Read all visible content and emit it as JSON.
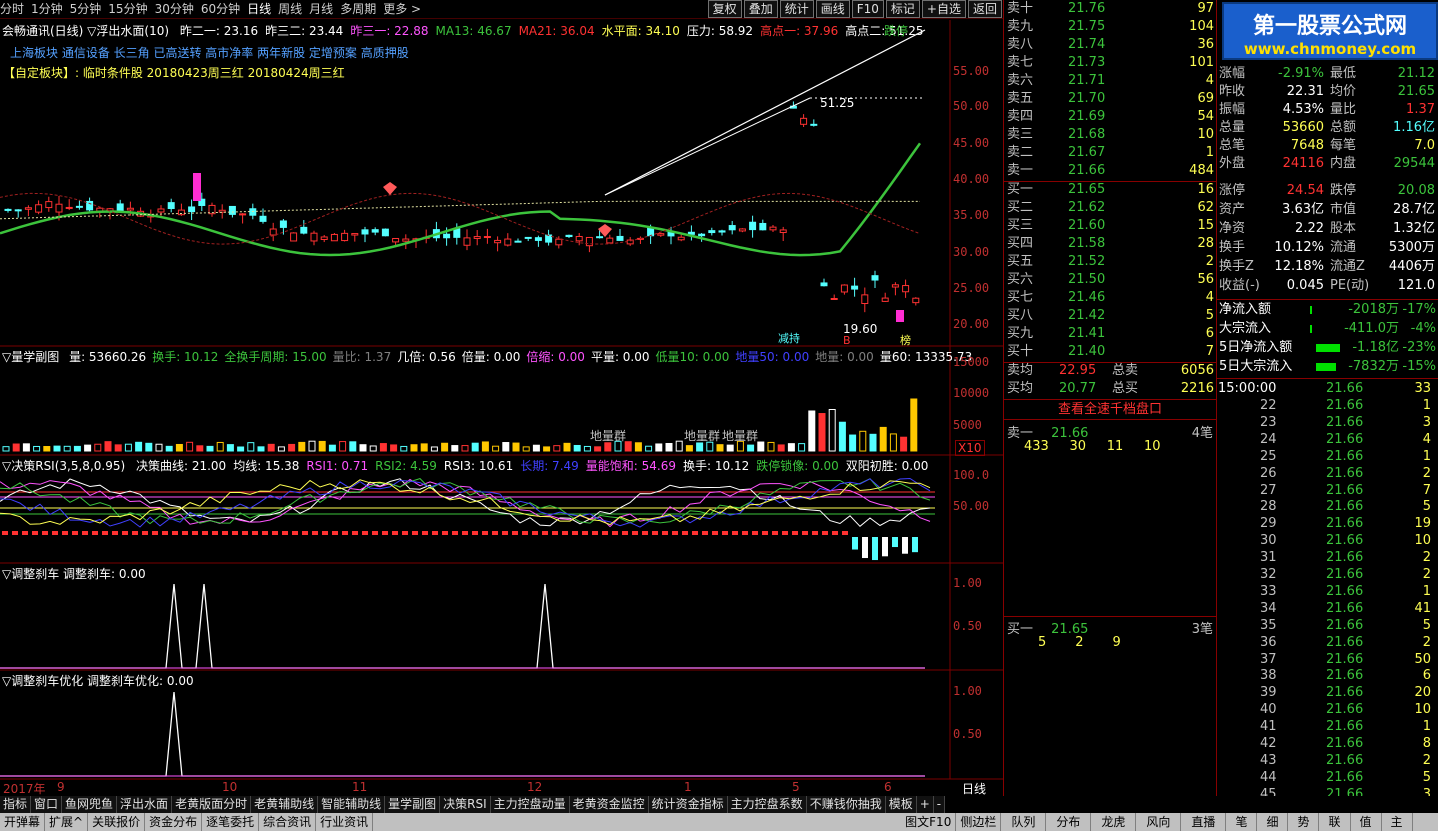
{
  "toolbar": {
    "periods": [
      "分时",
      "1分钟",
      "5分钟",
      "15分钟",
      "30分钟",
      "60分钟",
      "日线",
      "周线",
      "月线",
      "多周期",
      "更多 >"
    ],
    "active": "日线",
    "buttons": [
      "复权",
      "叠加",
      "统计",
      "画线",
      "F10",
      "标记",
      "+自选",
      "返回"
    ]
  },
  "watermark": {
    "title": "第一股票公式网",
    "url": "www.chnmoney.com"
  },
  "main_chart": {
    "title": "会畅通讯(日线) ▽浮出水面(10)",
    "ind": [
      {
        "label": "昨二一: 23.16",
        "color": "#ffffff"
      },
      {
        "label": "昨三二: 23.44",
        "color": "#ffffff"
      },
      {
        "label": "昨三一: 22.88",
        "color": "#ff54ff"
      },
      {
        "label": "MA13: 46.67",
        "color": "#3cc33c"
      },
      {
        "label": "MA21: 36.04",
        "color": "#ff3232"
      },
      {
        "label": "水平面: 34.10",
        "color": "#ffff54"
      },
      {
        "label": "压力: 58.92",
        "color": "#ffffff"
      },
      {
        "label": "高点一: 37.96",
        "color": "#ff3232"
      },
      {
        "label": "高点二: 51.25",
        "color": "#ffffff"
      }
    ],
    "tag": "跌停",
    "concepts": "上海板块 通信设备 长三角 已高送转 高市净率 两年新股 定增预案 高质押股",
    "custom": "【自定板块】: 临时条件股 20180423周三红 20180424周三红",
    "yticks": [
      "55.00",
      "50.00",
      "45.00",
      "40.00",
      "35.00",
      "30.00",
      "25.00",
      "20.00"
    ],
    "annot_high": "51.25",
    "annot_low": "19.60",
    "marks": [
      "减持",
      "B",
      "榜"
    ]
  },
  "vol_panel": {
    "title": "▽量学副图",
    "ind": [
      {
        "label": "量: 53660.26",
        "color": "#ffffff"
      },
      {
        "label": "换手: 10.12",
        "color": "#3cc33c"
      },
      {
        "label": "全换手周期: 15.00",
        "color": "#3cc33c"
      },
      {
        "label": "量比: 1.37",
        "color": "#808080"
      },
      {
        "label": "几倍: 0.56",
        "color": "#ffffff"
      },
      {
        "label": "倍量: 0.00",
        "color": "#ffffff"
      },
      {
        "label": "倍缩: 0.00",
        "color": "#ff54ff"
      },
      {
        "label": "平量: 0.00",
        "color": "#ffffff"
      },
      {
        "label": "低量10: 0.00",
        "color": "#3cc33c"
      },
      {
        "label": "地量50: 0.00",
        "color": "#4040ff"
      },
      {
        "label": "地量: 0.00",
        "color": "#808080"
      },
      {
        "label": "量60: 13335.73",
        "color": "#ffffff"
      }
    ],
    "yticks": [
      "15000",
      "10000",
      "5000"
    ],
    "ground_labels": [
      "地量群",
      "地量群",
      "地量群"
    ],
    "scale": "X10"
  },
  "rsi_panel": {
    "title": "▽决策RSI(3,5,8,0.95)",
    "ind": [
      {
        "label": "决策曲线: 21.00",
        "color": "#ffffff"
      },
      {
        "label": "均线: 15.38",
        "color": "#ffffff"
      },
      {
        "label": "RSI1: 0.71",
        "color": "#ff54ff"
      },
      {
        "label": "RSI2: 4.59",
        "color": "#3cc33c"
      },
      {
        "label": "RSI3: 10.61",
        "color": "#ffffff"
      },
      {
        "label": "长期: 7.49",
        "color": "#4040ff"
      },
      {
        "label": "量能饱和: 54.69",
        "color": "#ff54ff"
      },
      {
        "label": "换手: 10.12",
        "color": "#ffffff"
      },
      {
        "label": "跌停锁像: 0.00",
        "color": "#3cc33c"
      },
      {
        "label": "双阳初胜: 0.00",
        "color": "#ffffff"
      }
    ],
    "yticks": [
      "100.0",
      "50.00"
    ]
  },
  "brake_panel": {
    "title": "▽调整刹车 调整刹车: 0.00",
    "yticks": [
      "1.00",
      "0.50"
    ]
  },
  "brake2_panel": {
    "title": "▽调整刹车优化 调整刹车优化: 0.00",
    "yticks": [
      "1.00",
      "0.50"
    ]
  },
  "timeline": {
    "labels": [
      "2017年",
      "9",
      "10",
      "11",
      "12",
      "1",
      "5",
      "6"
    ],
    "period": "日线"
  },
  "quote": {
    "asks": [
      {
        "name": "卖十",
        "price": "21.76",
        "vol": "97"
      },
      {
        "name": "卖九",
        "price": "21.75",
        "vol": "104"
      },
      {
        "name": "卖八",
        "price": "21.74",
        "vol": "36"
      },
      {
        "name": "卖七",
        "price": "21.73",
        "vol": "101"
      },
      {
        "name": "卖六",
        "price": "21.71",
        "vol": "4"
      },
      {
        "name": "卖五",
        "price": "21.70",
        "vol": "69"
      },
      {
        "name": "卖四",
        "price": "21.69",
        "vol": "54"
      },
      {
        "name": "卖三",
        "price": "21.68",
        "vol": "10"
      },
      {
        "name": "卖二",
        "price": "21.67",
        "vol": "1"
      },
      {
        "name": "卖一",
        "price": "21.66",
        "vol": "484"
      }
    ],
    "bids": [
      {
        "name": "买一",
        "price": "21.65",
        "vol": "16"
      },
      {
        "name": "买二",
        "price": "21.62",
        "vol": "62"
      },
      {
        "name": "买三",
        "price": "21.60",
        "vol": "15"
      },
      {
        "name": "买四",
        "price": "21.58",
        "vol": "28"
      },
      {
        "name": "买五",
        "price": "21.52",
        "vol": "2"
      },
      {
        "name": "买六",
        "price": "21.50",
        "vol": "56"
      },
      {
        "name": "买七",
        "price": "21.46",
        "vol": "4"
      },
      {
        "name": "买八",
        "price": "21.42",
        "vol": "5"
      },
      {
        "name": "买九",
        "price": "21.41",
        "vol": "6"
      },
      {
        "name": "买十",
        "price": "21.40",
        "vol": "7"
      }
    ],
    "avg": [
      {
        "name": "卖均",
        "price": "22.95",
        "k": "总卖",
        "v": "6056"
      },
      {
        "name": "买均",
        "price": "20.77",
        "k": "总买",
        "v": "2216"
      }
    ],
    "full_depth_btn": "查看全速千档盘口",
    "ask1_summary": {
      "name": "卖一",
      "price": "21.66",
      "count": "4笔",
      "queue": [
        "433",
        "30",
        "11",
        "10"
      ]
    },
    "bid1_summary": {
      "name": "买一",
      "price": "21.65",
      "count": "3笔",
      "queue": [
        "5",
        "2",
        "9"
      ]
    }
  },
  "stats": [
    {
      "k1": "涨幅",
      "v1": "-2.91%",
      "k2": "最低",
      "v2": "21.12",
      "c1": "#3cc33c",
      "c2": "#3cc33c"
    },
    {
      "k1": "昨收",
      "v1": "22.31",
      "k2": "均价",
      "v2": "21.65",
      "c1": "#ffffff",
      "c2": "#3cc33c"
    },
    {
      "k1": "振幅",
      "v1": "4.53%",
      "k2": "量比",
      "v2": "1.37",
      "c1": "#ffffff",
      "c2": "#ff3232"
    },
    {
      "k1": "总量",
      "v1": "53660",
      "k2": "总额",
      "v2": "1.16亿",
      "c1": "#ffff54",
      "c2": "#54ffff"
    },
    {
      "k1": "总笔",
      "v1": "7648",
      "k2": "每笔",
      "v2": "7.0",
      "c1": "#ffff54",
      "c2": "#ffff54"
    },
    {
      "k1": "外盘",
      "v1": "24116",
      "k2": "内盘",
      "v2": "29544",
      "c1": "#ff3232",
      "c2": "#3cc33c"
    },
    {
      "k1": "涨停",
      "v1": "24.54",
      "k2": "跌停",
      "v2": "20.08",
      "c1": "#ff3232",
      "c2": "#3cc33c"
    },
    {
      "k1": "资产",
      "v1": "3.63亿",
      "k2": "市值",
      "v2": "28.7亿",
      "c1": "#ffffff",
      "c2": "#ffffff"
    },
    {
      "k1": "净资",
      "v1": "2.22",
      "k2": "股本",
      "v2": "1.32亿",
      "c1": "#ffffff",
      "c2": "#ffffff"
    },
    {
      "k1": "换手",
      "v1": "10.12%",
      "k2": "流通",
      "v2": "5300万",
      "c1": "#ffffff",
      "c2": "#ffffff"
    },
    {
      "k1": "换手Z",
      "v1": "12.18%",
      "k2": "流通Z",
      "v2": "4406万",
      "c1": "#ffffff",
      "c2": "#ffffff"
    },
    {
      "k1": "收益(-)",
      "v1": "0.045",
      "k2": "PE(动)",
      "v2": "121.0",
      "c1": "#ffffff",
      "c2": "#ffffff"
    }
  ],
  "flows": [
    {
      "k": "净流入额",
      "v": "-2018万",
      "p": "-17%"
    },
    {
      "k": "大宗流入",
      "v": "-411.0万",
      "p": "-4%"
    },
    {
      "k": "5日净流入额",
      "v": "-1.18亿",
      "p": "-23%"
    },
    {
      "k": "5日大宗流入",
      "v": "-7832万",
      "p": "-15%"
    }
  ],
  "ticks": {
    "header_time": "15:00:00",
    "header_vol": "33",
    "rows": [
      {
        "n": "22",
        "p": "21.66",
        "v": "1"
      },
      {
        "n": "23",
        "p": "21.66",
        "v": "3"
      },
      {
        "n": "24",
        "p": "21.66",
        "v": "4"
      },
      {
        "n": "25",
        "p": "21.66",
        "v": "1"
      },
      {
        "n": "26",
        "p": "21.66",
        "v": "2"
      },
      {
        "n": "27",
        "p": "21.66",
        "v": "7"
      },
      {
        "n": "28",
        "p": "21.66",
        "v": "5"
      },
      {
        "n": "29",
        "p": "21.66",
        "v": "19"
      },
      {
        "n": "30",
        "p": "21.66",
        "v": "10"
      },
      {
        "n": "31",
        "p": "21.66",
        "v": "2"
      },
      {
        "n": "32",
        "p": "21.66",
        "v": "2"
      },
      {
        "n": "33",
        "p": "21.66",
        "v": "1"
      },
      {
        "n": "34",
        "p": "21.66",
        "v": "41"
      },
      {
        "n": "35",
        "p": "21.66",
        "v": "5"
      },
      {
        "n": "36",
        "p": "21.66",
        "v": "2"
      },
      {
        "n": "37",
        "p": "21.66",
        "v": "50"
      },
      {
        "n": "38",
        "p": "21.66",
        "v": "6"
      },
      {
        "n": "39",
        "p": "21.66",
        "v": "20"
      },
      {
        "n": "40",
        "p": "21.66",
        "v": "10"
      },
      {
        "n": "41",
        "p": "21.66",
        "v": "1"
      },
      {
        "n": "42",
        "p": "21.66",
        "v": "8"
      },
      {
        "n": "43",
        "p": "21.66",
        "v": "2"
      },
      {
        "n": "44",
        "p": "21.66",
        "v": "5"
      },
      {
        "n": "45",
        "p": "21.66",
        "v": "3"
      }
    ]
  },
  "bottom": {
    "row1": [
      "指标",
      "窗口",
      "鱼网兜鱼",
      "浮出水面",
      "老黄版面分时",
      "老黄辅助线",
      "智能辅助线",
      "量学副图",
      "决策RSI",
      "主力控盘动量",
      "老黄资金监控",
      "统计资金指标",
      "主力控盘系数",
      "不赚钱你抽我",
      "模板",
      "+",
      "-"
    ],
    "row2": [
      "开弹幕",
      "扩展^",
      "关联报价",
      "资金分布",
      "逐笔委托",
      "综合资讯",
      "行业资讯"
    ],
    "row2_right": [
      "图文F10",
      "侧边栏",
      "队列",
      "分布",
      "龙虎",
      "风向",
      "直播",
      "笔",
      "细",
      "势",
      "联",
      "值",
      "主"
    ]
  }
}
